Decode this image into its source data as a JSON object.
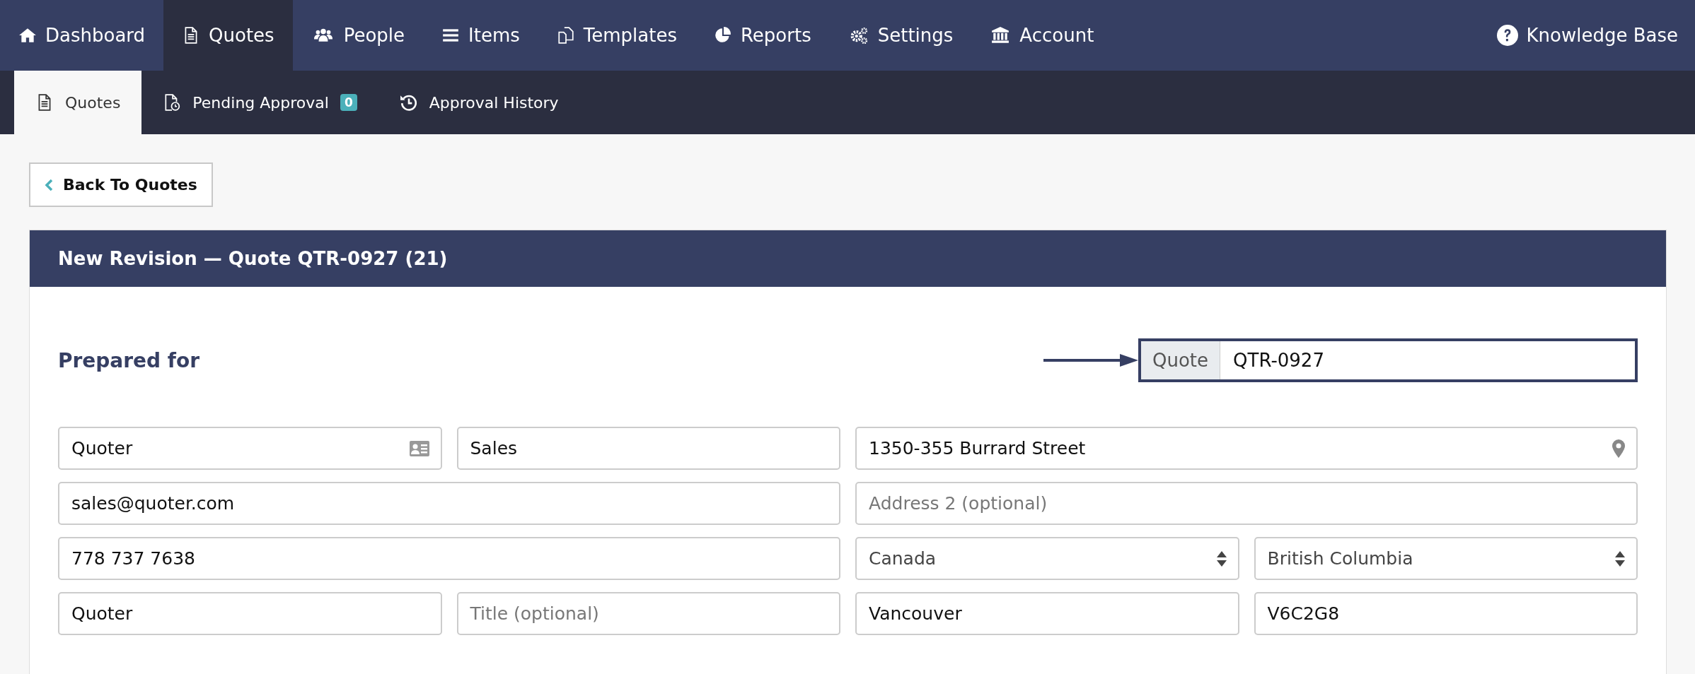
{
  "main_nav": {
    "items": [
      {
        "label": "Dashboard",
        "kind": "home",
        "selected": false
      },
      {
        "label": "Quotes",
        "kind": "document",
        "selected": true
      },
      {
        "label": "People",
        "kind": "people",
        "selected": false
      },
      {
        "label": "Items",
        "kind": "list",
        "selected": false
      },
      {
        "label": "Templates",
        "kind": "copy",
        "selected": false
      },
      {
        "label": "Reports",
        "kind": "pie",
        "selected": false
      },
      {
        "label": "Settings",
        "kind": "gears",
        "selected": false
      },
      {
        "label": "Account",
        "kind": "bank",
        "selected": false
      }
    ],
    "help": {
      "label": "Knowledge Base"
    }
  },
  "sub_nav": {
    "items": [
      {
        "label": "Quotes",
        "kind": "document",
        "selected": true
      },
      {
        "label": "Pending Approval",
        "kind": "pending",
        "selected": false,
        "badge": "0"
      },
      {
        "label": "Approval History",
        "kind": "history",
        "selected": false
      }
    ]
  },
  "back_button": {
    "label": "Back To Quotes"
  },
  "card": {
    "title": "New Revision — Quote QTR-0927 (21)",
    "section_title": "Prepared for",
    "quote_field": {
      "addon": "Quote",
      "value": "QTR-0927"
    },
    "contact_rows": [
      [
        {
          "kind": "lookup",
          "value": "Quoter"
        },
        {
          "kind": "text",
          "value": "Sales"
        }
      ],
      [
        {
          "kind": "text",
          "value": "sales@quoter.com"
        }
      ],
      [
        {
          "kind": "text",
          "value": "778 737 7638"
        }
      ],
      [
        {
          "kind": "text",
          "value": "Quoter"
        },
        {
          "kind": "text",
          "placeholder": "Title (optional)"
        }
      ]
    ],
    "address_rows": [
      [
        {
          "kind": "location",
          "value": "1350-355 Burrard Street"
        }
      ],
      [
        {
          "kind": "text",
          "placeholder": "Address 2 (optional)"
        }
      ],
      [
        {
          "kind": "select",
          "value": "Canada"
        },
        {
          "kind": "select",
          "value": "British Columbia"
        }
      ],
      [
        {
          "kind": "text",
          "value": "Vancouver"
        },
        {
          "kind": "text",
          "value": "V6C2G8"
        }
      ]
    ]
  }
}
